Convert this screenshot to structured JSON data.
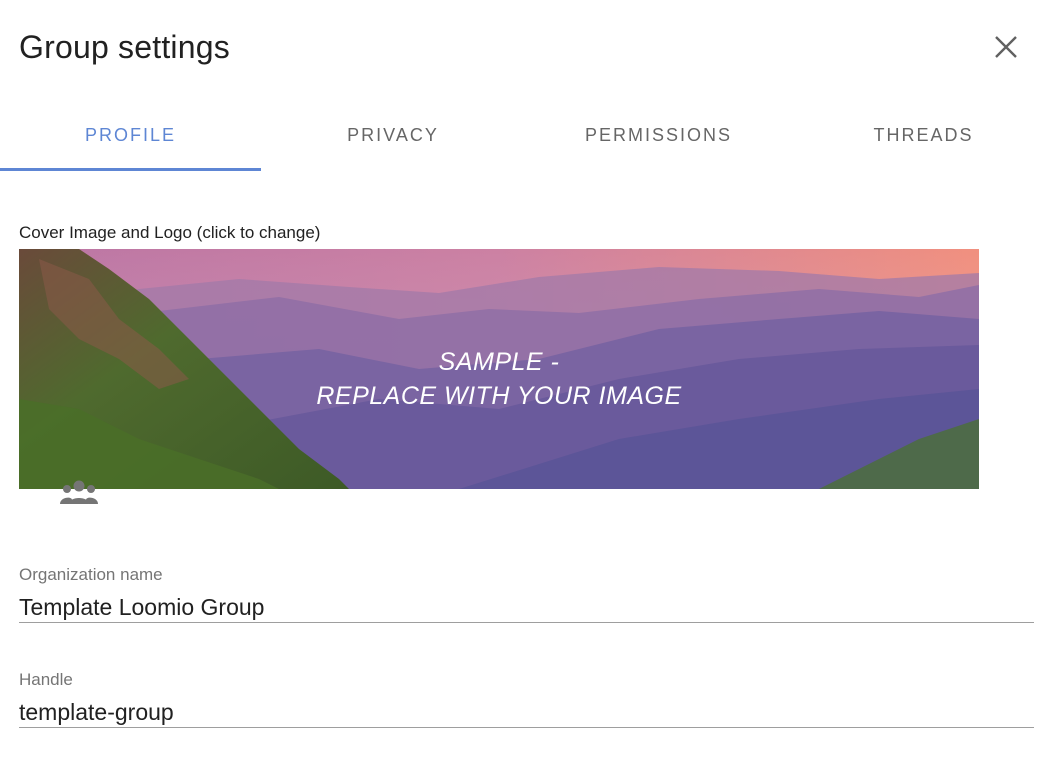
{
  "dialog": {
    "title": "Group settings",
    "close_icon": "close-icon"
  },
  "tabs": [
    {
      "label": "PROFILE",
      "active": true
    },
    {
      "label": "PRIVACY",
      "active": false
    },
    {
      "label": "PERMISSIONS",
      "active": false
    },
    {
      "label": "THREADS",
      "active": false
    }
  ],
  "cover": {
    "label": "Cover Image and Logo (click to change)",
    "caption_line1": "SAMPLE -",
    "caption_line2": "REPLACE WITH YOUR IMAGE",
    "logo_icon": "group-icon"
  },
  "form": {
    "org_name": {
      "label": "Organization name",
      "value": "Template Loomio Group"
    },
    "handle": {
      "label": "Handle",
      "value": "template-group"
    }
  },
  "colors": {
    "accent": "#5e86d4",
    "tab_text": "#666666",
    "field_border": "#9e9e9e"
  }
}
